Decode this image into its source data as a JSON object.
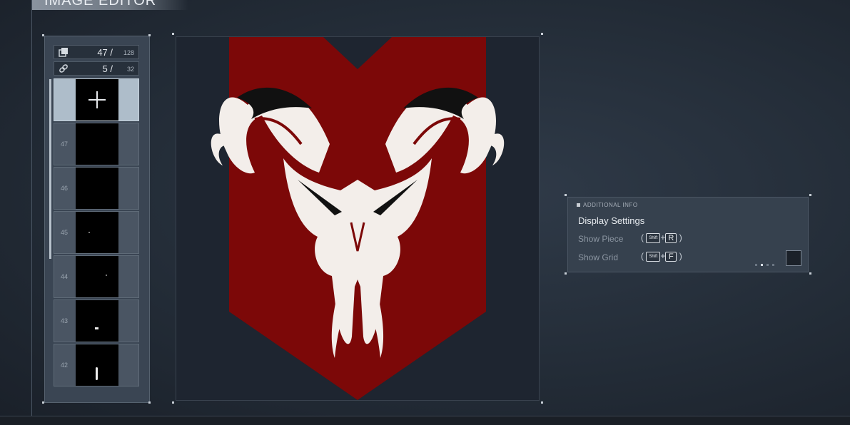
{
  "app": {
    "title": "IMAGE EDITOR"
  },
  "counters": {
    "layers": {
      "value": "47 /",
      "max": "128",
      "icon": "layers-icon"
    },
    "links": {
      "value": "5 /",
      "max": "32",
      "icon": "link-icon"
    }
  },
  "layers": [
    {
      "number": "47",
      "mark": "none"
    },
    {
      "number": "46",
      "mark": "none"
    },
    {
      "number": "45",
      "mark": "dot"
    },
    {
      "number": "44",
      "mark": "dot"
    },
    {
      "number": "43",
      "mark": "dash"
    },
    {
      "number": "42",
      "mark": "sliver"
    }
  ],
  "info": {
    "section": "ADDITIONAL INFO",
    "title": "Display Settings",
    "rows": [
      {
        "label": "Show Piece",
        "modifier": "Shift",
        "key": "R"
      },
      {
        "label": "Show Grid",
        "modifier": "Shift",
        "key": "F"
      }
    ]
  },
  "colors": {
    "emblem_red": "#7c0808",
    "emblem_bone": "#f3eeea",
    "accent": "#aebdca"
  }
}
